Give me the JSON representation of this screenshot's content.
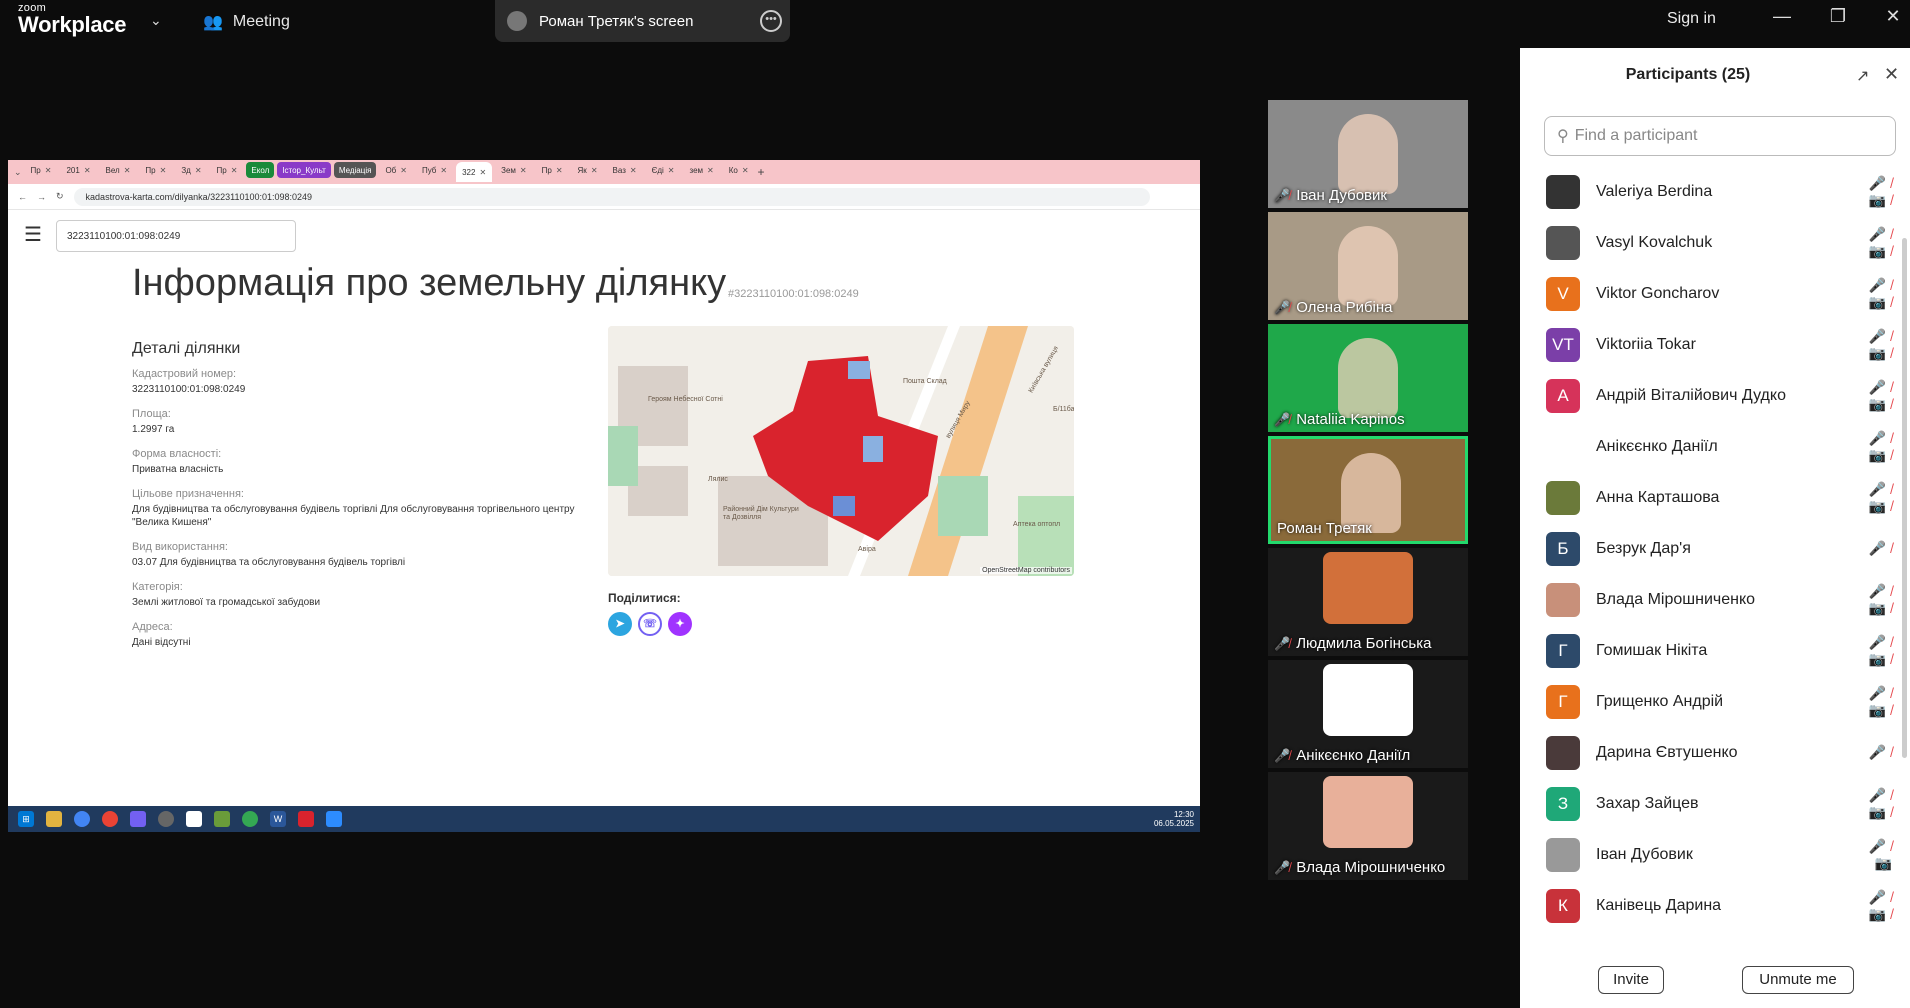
{
  "app": {
    "logo_top": "zoom",
    "logo_bottom": "Workplace",
    "meeting_label": "Meeting",
    "share_pill": "Роман Третяк's screen",
    "signin": "Sign in"
  },
  "browser": {
    "tabs": [
      "Пр",
      "201",
      "Вел",
      "Пр",
      "Зд",
      "Пр",
      "Екол",
      "Істор_Культ",
      "Медіація",
      "Об",
      "Пуб",
      "322",
      "Зем",
      "Пр",
      "Як",
      "Ваз",
      "Єді",
      "зем",
      "Ко"
    ],
    "url": "kadastrova-karta.com/dilyanka/3223110100:01:098:0249"
  },
  "page": {
    "search_value": "3223110100:01:098:0249",
    "title": "Інформація про земельну ділянку",
    "title_id": "#3223110100:01:098:0249",
    "details_heading": "Деталі ділянки",
    "fields": [
      {
        "label": "Кадастровий номер:",
        "value": "3223110100:01:098:0249"
      },
      {
        "label": "Площа:",
        "value": "1.2997 га"
      },
      {
        "label": "Форма власності:",
        "value": "Приватна власність"
      },
      {
        "label": "Цільове призначення:",
        "value": "Для будівництва та обслуговування будівель торгівлі Для обслуговування торгівельного центру \"Велика Кишеня\""
      },
      {
        "label": "Вид використання:",
        "value": "03.07 Для будівництва та обслуговування будівель торгівлі"
      },
      {
        "label": "Категорія:",
        "value": "Землі житлової та громадської забудови"
      },
      {
        "label": "Адреса:",
        "value": "Дані відсутні"
      }
    ],
    "map_attribution": "OpenStreetMap contributors",
    "map_labels": [
      "вулиця Миру",
      "Київська вулиця",
      "Пошта Склад",
      "Районний Дім Культури та Дозвілля",
      "Лялис",
      "Аптека оптопл",
      "Героям Небесної Сотні",
      "Авіра",
      "Б/11ба"
    ],
    "share_heading": "Поділитися:",
    "clock_time": "12:30",
    "clock_date": "06.05.2025"
  },
  "gallery": [
    {
      "name": "Іван Дубовик",
      "muted": true
    },
    {
      "name": "Олена Рибіна",
      "muted": true
    },
    {
      "name": "Nataliia Kapinos",
      "muted": true
    },
    {
      "name": "Роман Третяк",
      "muted": false
    },
    {
      "name": "Людмила Богінська",
      "muted": true
    },
    {
      "name": "Анікєєнко Даніїл",
      "muted": true
    },
    {
      "name": "Влада Мірошниченко",
      "muted": true
    }
  ],
  "participants": {
    "title": "Participants (25)",
    "search_placeholder": "Find a participant",
    "list": [
      {
        "name": "Valeriya Berdina",
        "initial": "",
        "color": "#333"
      },
      {
        "name": "Vasyl Kovalchuk",
        "initial": "",
        "color": "#555"
      },
      {
        "name": "Viktor Goncharov",
        "initial": "V",
        "color": "#e8711c"
      },
      {
        "name": "Viktoriia Tokar",
        "initial": "VT",
        "color": "#7b3fa8"
      },
      {
        "name": "Андрій Віталійович Дудко",
        "initial": "А",
        "color": "#d6335a"
      },
      {
        "name": "Анікєєнко Даніїл",
        "initial": "",
        "color": "#ffffff"
      },
      {
        "name": "Анна Карташова",
        "initial": "",
        "color": "#6b7a3a"
      },
      {
        "name": "Безрук Дар'я",
        "initial": "Б",
        "color": "#2d4a6a"
      },
      {
        "name": "Влада Мірошниченко",
        "initial": "",
        "color": "#c8907a"
      },
      {
        "name": "Гомишак Нікіта",
        "initial": "Г",
        "color": "#2d4a6a"
      },
      {
        "name": "Грищенко Андрій",
        "initial": "Г",
        "color": "#e8711c"
      },
      {
        "name": "Дарина Євтушенко",
        "initial": "",
        "color": "#4a3a3a"
      },
      {
        "name": "Захар Зайцев",
        "initial": "З",
        "color": "#1fa878"
      },
      {
        "name": "Іван Дубовик",
        "initial": "",
        "color": "#999"
      },
      {
        "name": "Канівець Дарина",
        "initial": "К",
        "color": "#c8323a"
      }
    ],
    "invite": "Invite",
    "unmute": "Unmute me"
  },
  "colors": {
    "accent_green": "#23d96c",
    "muted_red": "#e5484d",
    "plot_red": "#d9232d"
  }
}
